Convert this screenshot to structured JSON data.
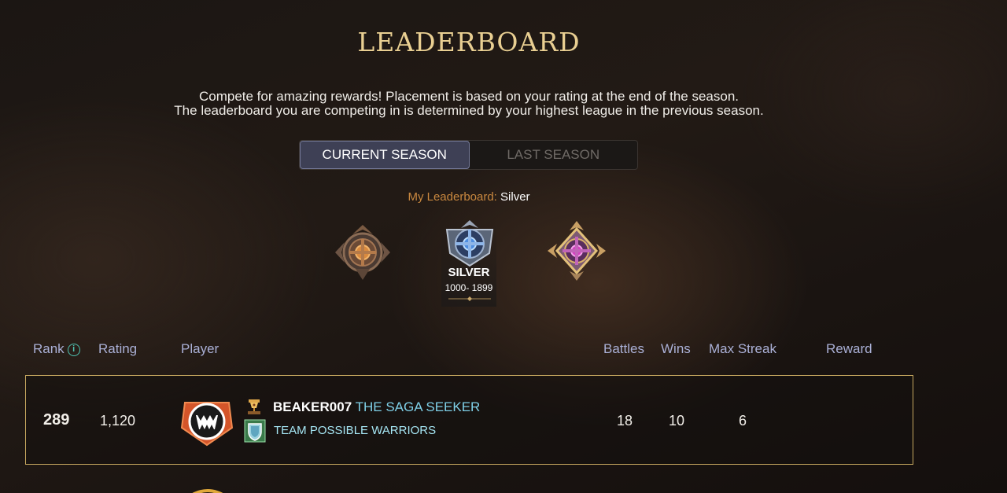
{
  "header": {
    "title": "LEADERBOARD",
    "desc_line1": "Compete for amazing rewards! Placement is based on your rating at the end of the season.",
    "desc_line2": "The leaderboard you are competing in is determined by your highest league in the previous season."
  },
  "tabs": {
    "current": "CURRENT SEASON",
    "last": "LAST SEASON",
    "active": "current"
  },
  "my_leaderboard": {
    "label": "My Leaderboard:",
    "value": "Silver"
  },
  "leagues": [
    {
      "icon": "bronze-league-icon"
    },
    {
      "icon": "silver-league-icon",
      "name": "SILVER",
      "range": "1000- 1899",
      "selected": true
    },
    {
      "icon": "gold-league-icon"
    }
  ],
  "columns": {
    "rank": "Rank",
    "rating": "Rating",
    "player": "Player",
    "battles": "Battles",
    "wins": "Wins",
    "max_streak": "Max Streak",
    "reward": "Reward"
  },
  "rows": [
    {
      "rank": "289",
      "rating": "1,120",
      "avatar_icon": "monster-avatar-icon",
      "player": "BEAKER007",
      "player_title": "THE SAGA SEEKER",
      "guild": "TEAM POSSIBLE WARRIORS",
      "battles": "18",
      "wins": "10",
      "max_streak": "6"
    }
  ],
  "colors": {
    "title_gold": "#e9cf92",
    "accent_orange": "#c9883f",
    "column_header": "#aab0d6",
    "row_border": "#c6a75f",
    "player_title": "#7fd0e8",
    "guild": "#a6e6f4"
  }
}
